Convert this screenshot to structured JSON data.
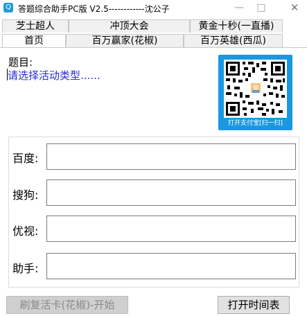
{
  "window": {
    "title": "答题综合助手PC版 V2.5------------沈公子",
    "icon": "Q"
  },
  "tabs_row1": [
    {
      "label": "芝士超人",
      "active": false
    },
    {
      "label": "冲顶大会",
      "active": false
    },
    {
      "label": "黄金十秒(一直播)",
      "active": false
    }
  ],
  "tabs_row2": [
    {
      "label": "首页",
      "active": true
    },
    {
      "label": "百万赢家(花椒)",
      "active": false
    },
    {
      "label": "百万英雄(西瓜)",
      "active": false
    }
  ],
  "main": {
    "question_label": "题目:",
    "activity_placeholder": "请选择活动类型......",
    "qr_caption": "打开支付宝[扫一扫]",
    "rows": [
      {
        "label": "百度:",
        "value": ""
      },
      {
        "label": "搜狗:",
        "value": ""
      },
      {
        "label": "优视:",
        "value": ""
      },
      {
        "label": "助手:",
        "value": ""
      }
    ]
  },
  "buttons": {
    "refresh_label": "刷复活卡(花椒)-开始",
    "schedule_label": "打开时间表"
  },
  "colors": {
    "qr_frame": "#1a97e0",
    "activity_text": "#2b2bd0"
  }
}
